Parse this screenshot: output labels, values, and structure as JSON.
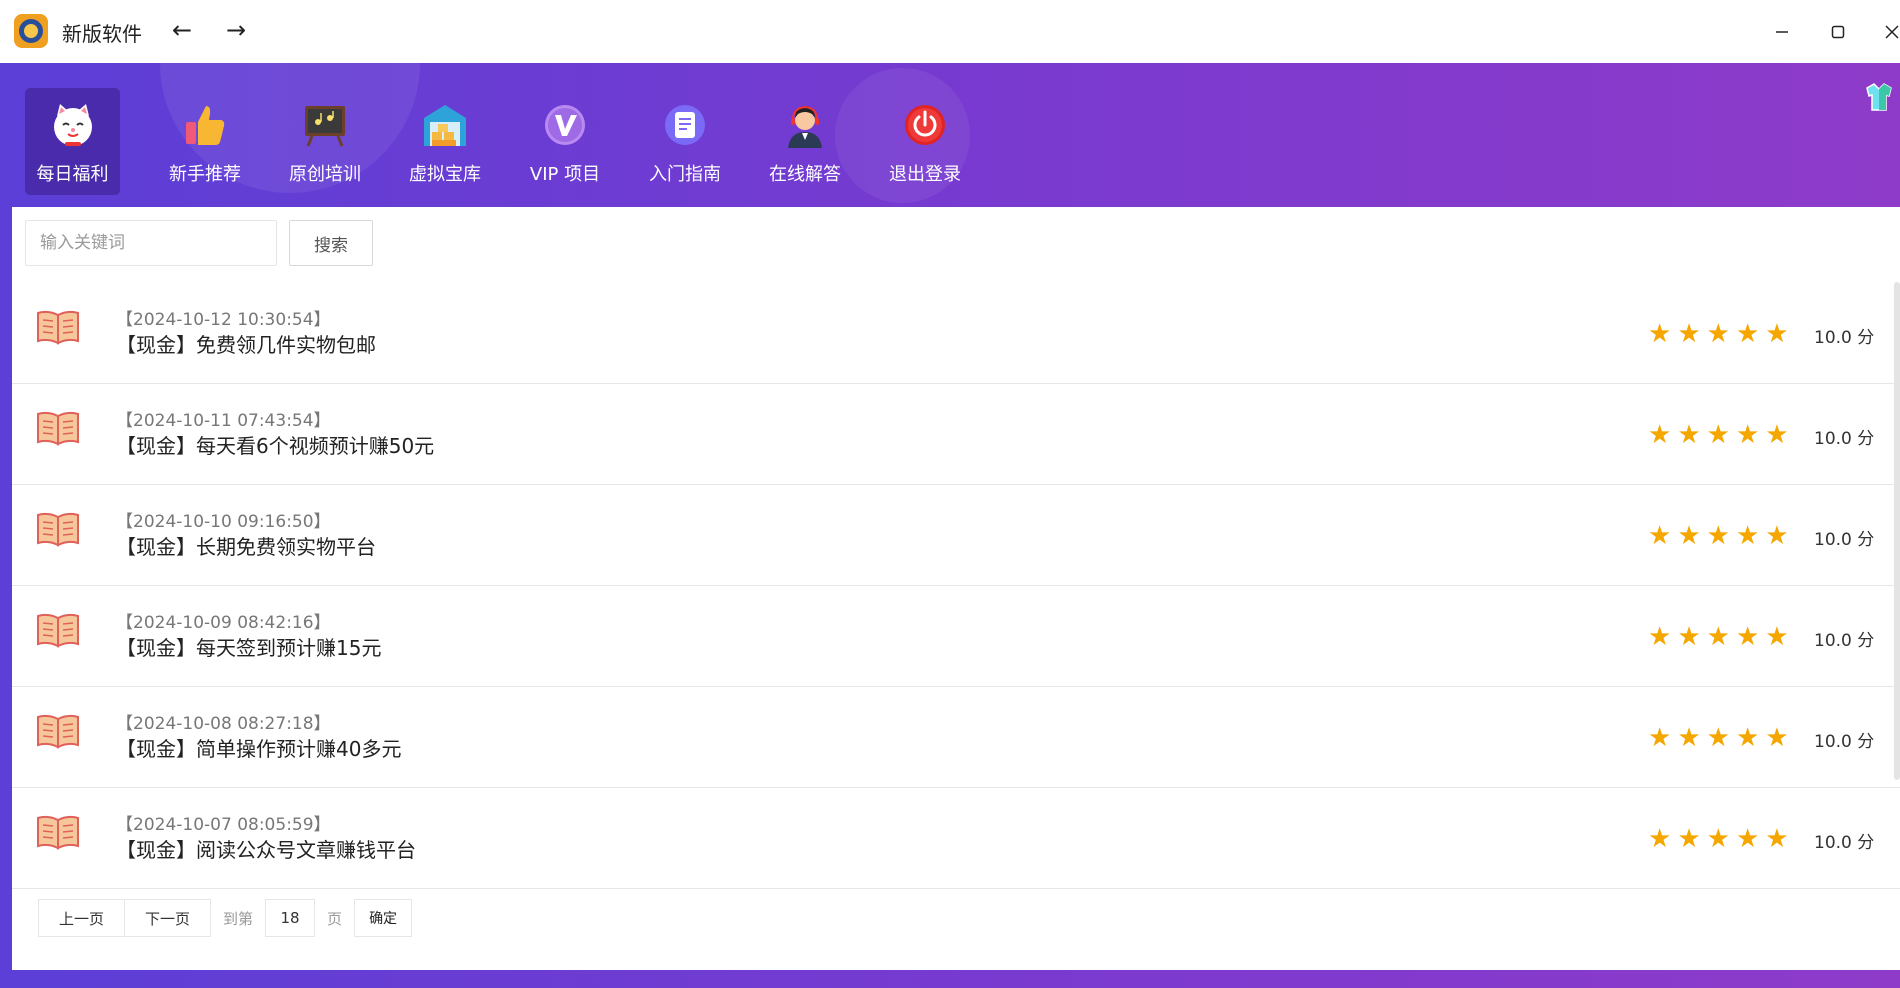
{
  "window": {
    "title": "新版软件",
    "back_icon": "←",
    "forward_icon": "→",
    "minimize_icon": "—",
    "maximize_icon": "☐",
    "close_icon": "✕"
  },
  "nav": {
    "items": [
      {
        "label": "每日福利",
        "icon": "lucky-cat-icon",
        "active": true
      },
      {
        "label": "新手推荐",
        "icon": "thumbs-up-icon"
      },
      {
        "label": "原创培训",
        "icon": "chalkboard-icon"
      },
      {
        "label": "虚拟宝库",
        "icon": "warehouse-icon"
      },
      {
        "label": "VIP 项目",
        "icon": "vip-icon"
      },
      {
        "label": "入门指南",
        "icon": "document-icon"
      },
      {
        "label": "在线解答",
        "icon": "support-agent-icon"
      },
      {
        "label": "退出登录",
        "icon": "power-icon"
      }
    ]
  },
  "search": {
    "placeholder": "输入关键词",
    "button_label": "搜索"
  },
  "list": {
    "items": [
      {
        "date": "【2024-10-12 10:30:54】",
        "title": "【现金】免费领几件实物包邮",
        "stars": 5,
        "score": "10.0 分"
      },
      {
        "date": "【2024-10-11 07:43:54】",
        "title": "【现金】每天看6个视频预计赚50元",
        "stars": 5,
        "score": "10.0 分"
      },
      {
        "date": "【2024-10-10 09:16:50】",
        "title": "【现金】长期免费领实物平台",
        "stars": 5,
        "score": "10.0 分"
      },
      {
        "date": "【2024-10-09 08:42:16】",
        "title": "【现金】每天签到预计赚15元",
        "stars": 5,
        "score": "10.0 分"
      },
      {
        "date": "【2024-10-08 08:27:18】",
        "title": "【现金】简单操作预计赚40多元",
        "stars": 5,
        "score": "10.0 分"
      },
      {
        "date": "【2024-10-07 08:05:59】",
        "title": "【现金】阅读公众号文章赚钱平台",
        "stars": 5,
        "score": "10.0 分"
      }
    ]
  },
  "pager": {
    "prev_label": "上一页",
    "next_label": "下一页",
    "goto_label": "到第",
    "page_value": "18",
    "page_suffix": "页",
    "confirm_label": "确定"
  },
  "colors": {
    "frame_start": "#5b3fd6",
    "frame_end": "#8e3bc9",
    "star": "#f5a700"
  }
}
